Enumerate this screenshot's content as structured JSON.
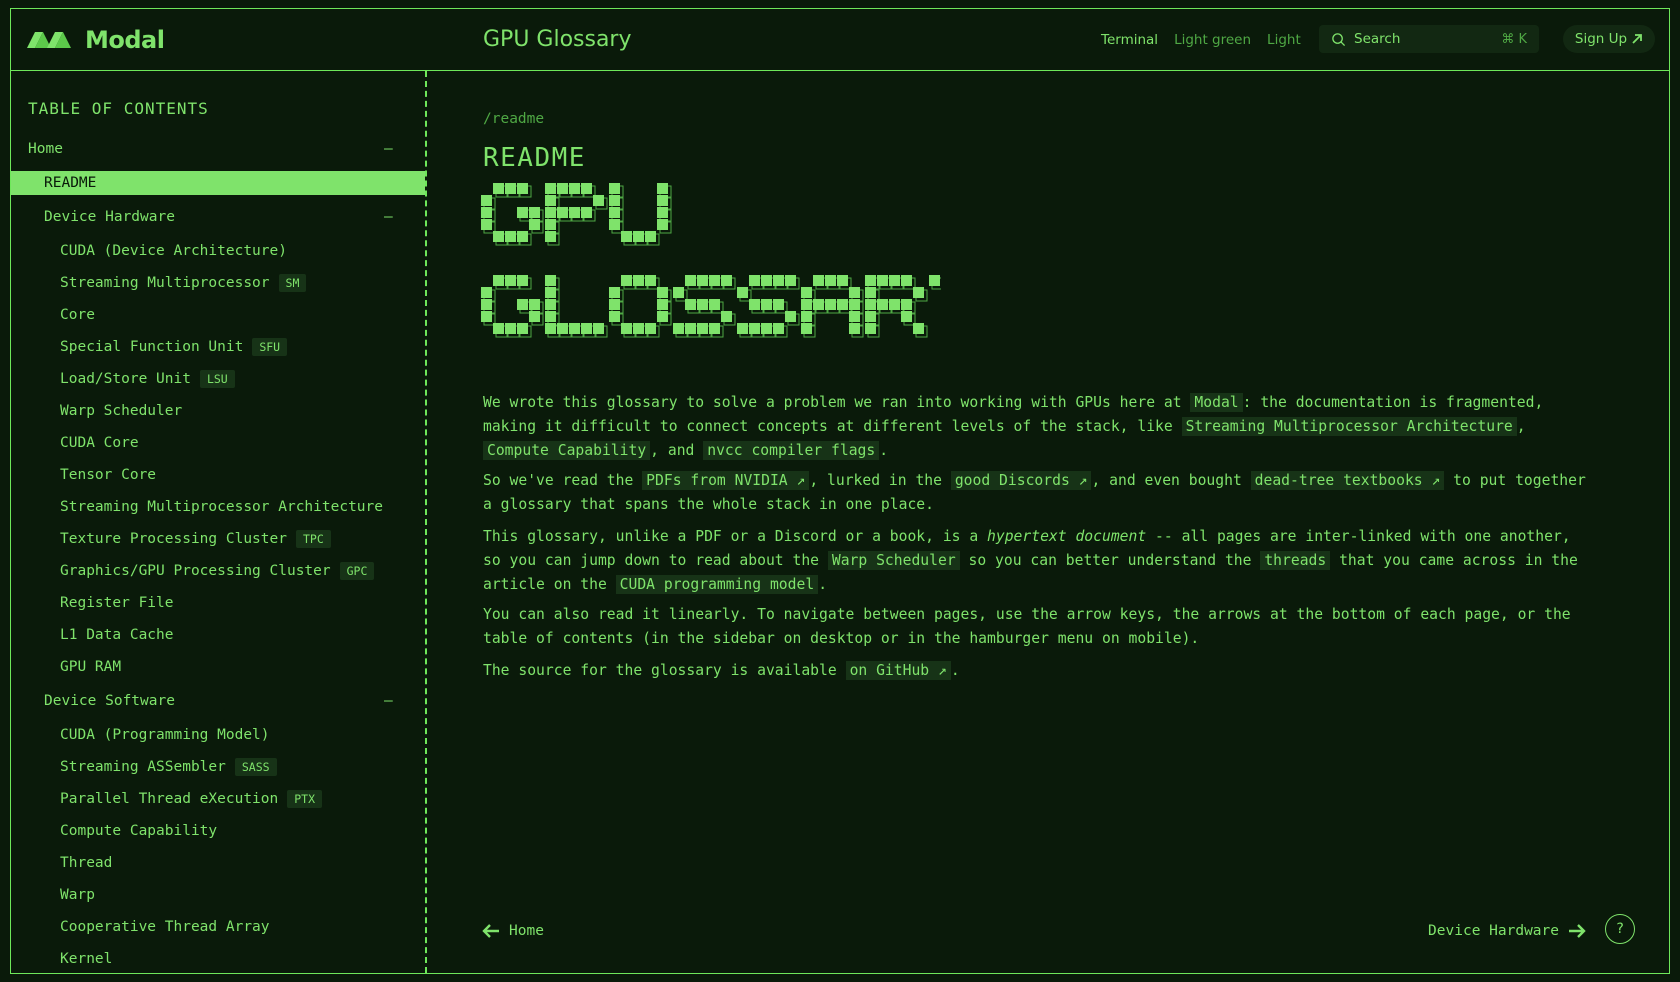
{
  "header": {
    "brand": "Modal",
    "site_title": "GPU Glossary",
    "themes": [
      "Terminal",
      "Light green",
      "Light"
    ],
    "active_theme": "Terminal",
    "search_label": "Search",
    "search_shortcut": "⌘ K",
    "signup_label": "Sign Up",
    "signup_icon": "arrow-up-right-icon"
  },
  "sidebar": {
    "title": "TABLE OF CONTENTS",
    "sections": [
      {
        "label": "Home",
        "collapsible": true
      },
      {
        "label": "README",
        "active": true
      },
      {
        "label": "Device Hardware",
        "collapsible": true,
        "items": [
          {
            "label": "CUDA (Device Architecture)"
          },
          {
            "label": "Streaming Multiprocessor",
            "abbr": "SM"
          },
          {
            "label": "Core"
          },
          {
            "label": "Special Function Unit",
            "abbr": "SFU"
          },
          {
            "label": "Load/Store Unit",
            "abbr": "LSU"
          },
          {
            "label": "Warp Scheduler"
          },
          {
            "label": "CUDA Core"
          },
          {
            "label": "Tensor Core"
          },
          {
            "label": "Streaming Multiprocessor Architecture"
          },
          {
            "label": "Texture Processing Cluster",
            "abbr": "TPC"
          },
          {
            "label": "Graphics/GPU Processing Cluster",
            "abbr": "GPC"
          },
          {
            "label": "Register File"
          },
          {
            "label": "L1 Data Cache"
          },
          {
            "label": "GPU RAM"
          }
        ]
      },
      {
        "label": "Device Software",
        "collapsible": true,
        "items": [
          {
            "label": "CUDA (Programming Model)"
          },
          {
            "label": "Streaming ASSembler",
            "abbr": "SASS"
          },
          {
            "label": "Parallel Thread eXecution",
            "abbr": "PTX"
          },
          {
            "label": "Compute Capability"
          },
          {
            "label": "Thread"
          },
          {
            "label": "Warp"
          },
          {
            "label": "Cooperative Thread Array"
          },
          {
            "label": "Kernel"
          }
        ]
      }
    ]
  },
  "main": {
    "path": "/readme",
    "heading": "README",
    "ascii_art_text": "GPU GLOSSARY",
    "paragraphs": [
      {
        "text_1": "We wrote this glossary to solve a problem we ran into working with GPUs here at ",
        "link_modal": "Modal",
        "text_2": ": the documentation is fragmented, making it difficult to connect concepts at different levels of the stack, like ",
        "link_sma": "Streaming Multiprocessor Architecture",
        "text_3": ", ",
        "link_cc": "Compute Capability",
        "text_4": ", and ",
        "link_nvcc": "nvcc compiler flags",
        "text_5": "."
      },
      {
        "text_1": "So we've read the ",
        "link_pdfs": "PDFs from NVIDIA ↗",
        "text_2": ", lurked in the ",
        "link_discords": "good Discords ↗",
        "text_3": ", and even bought ",
        "link_books": "dead-tree textbooks ↗",
        "text_4": " to put together a glossary that spans the whole stack in one place."
      },
      {
        "text_1": "This glossary, unlike a PDF or a Discord or a book, is a ",
        "emph": "hypertext document",
        "text_2": " -- all pages are inter-linked with one another, so you can jump down to read about the ",
        "link_ws": "Warp Scheduler",
        "text_3": " so you can better understand the ",
        "link_threads": "threads",
        "text_4": " that you came across in the article on the ",
        "link_cpm": "CUDA programming model",
        "text_5": "."
      },
      {
        "text_1": "You can also read it linearly. To navigate between pages, use the arrow keys, the arrows at the bottom of each page, or the table of contents (in the sidebar on desktop or in the hamburger menu on mobile)."
      },
      {
        "text_1": "The source for the glossary is available ",
        "link_github": "on GitHub ↗",
        "text_2": "."
      }
    ],
    "nav": {
      "prev_label": "Home",
      "next_label": "Device Hardware",
      "help_label": "?"
    }
  },
  "colors": {
    "background": "#0a1a0a",
    "accent": "#7fe36b",
    "muted": "#4fa844",
    "highlight_bg": "#173317"
  }
}
